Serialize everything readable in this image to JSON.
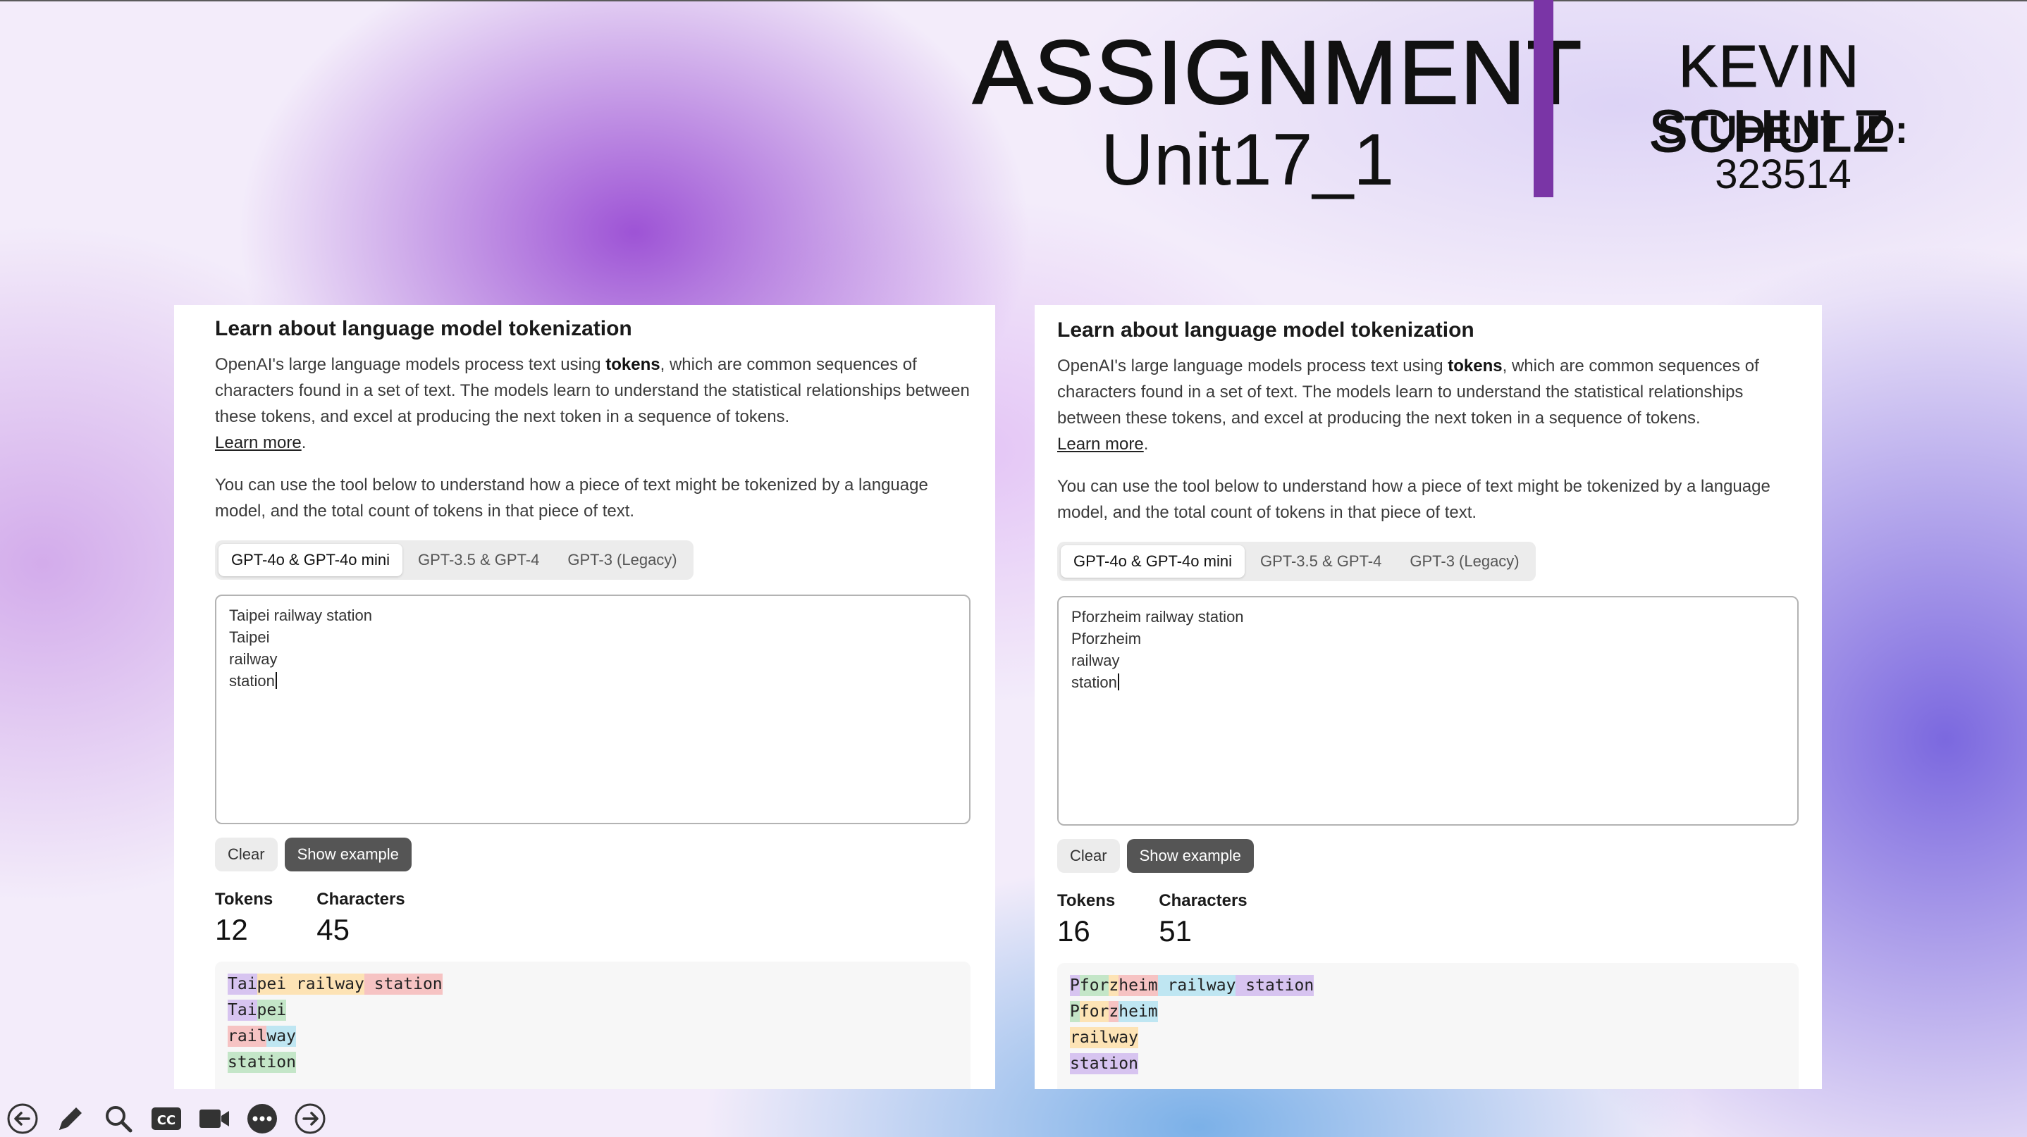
{
  "header": {
    "title": "ASSIGNMENT",
    "subtitle": "Unit17_1",
    "student_name": "KEVIN SCHULZ",
    "student_id_label": "STUDENT ID:",
    "student_id": "323514",
    "accent_color": "#7a35a6"
  },
  "panels": [
    {
      "title": "Learn about language model tokenization",
      "intro_before": "OpenAI's large language models process text using ",
      "intro_bold": "tokens",
      "intro_after": ", which are common sequences of characters found in a set of text. The models learn to understand the statistical relationships between these tokens, and excel at producing the next token in a sequence of tokens.",
      "learn_more": "Learn more",
      "learn_more_suffix": ".",
      "paragraph2": "You can use the tool below to understand how a piece of text might be tokenized by a language model, and the total count of tokens in that piece of text.",
      "tabs": [
        "GPT-4o & GPT-4o mini",
        "GPT-3.5 & GPT-4",
        "GPT-3 (Legacy)"
      ],
      "active_tab": 0,
      "input_lines": [
        "Taipei railway station",
        "Taipei",
        "railway",
        "station"
      ],
      "buttons": {
        "clear": "Clear",
        "example": "Show example"
      },
      "stats": {
        "tokens_label": "Tokens",
        "tokens": "12",
        "chars_label": "Characters",
        "chars": "45"
      },
      "token_lines": [
        [
          {
            "t": "Tai",
            "c": "#d7c4f0"
          },
          {
            "t": "pei",
            "c": "#fde3b5"
          },
          {
            "t": " railway",
            "c": "#fde3b5"
          },
          {
            "t": " station",
            "c": "#f6c3c3"
          }
        ],
        [
          {
            "t": "Tai",
            "c": "#d7c4f0"
          },
          {
            "t": "pei",
            "c": "#c4e6c8"
          }
        ],
        [
          {
            "t": "rail",
            "c": "#f6c3c3"
          },
          {
            "t": "way",
            "c": "#bfe6f2"
          }
        ],
        [
          {
            "t": "station",
            "c": "#c4e6c8"
          }
        ]
      ]
    },
    {
      "title": "Learn about language model tokenization",
      "intro_before": "OpenAI's large language models process text using ",
      "intro_bold": "tokens",
      "intro_after": ", which are common sequences of characters found in a set of text. The models learn to understand the statistical relationships between these tokens, and excel at producing the next token in a sequence of tokens.",
      "learn_more": "Learn more",
      "learn_more_suffix": ".",
      "paragraph2": "You can use the tool below to understand how a piece of text might be tokenized by a language model, and the total count of tokens in that piece of text.",
      "tabs": [
        "GPT-4o & GPT-4o mini",
        "GPT-3.5 & GPT-4",
        "GPT-3 (Legacy)"
      ],
      "active_tab": 0,
      "input_lines": [
        "Pforzheim railway station",
        "Pforzheim",
        "railway",
        "station"
      ],
      "buttons": {
        "clear": "Clear",
        "example": "Show example"
      },
      "stats": {
        "tokens_label": "Tokens",
        "tokens": "16",
        "chars_label": "Characters",
        "chars": "51"
      },
      "token_lines": [
        [
          {
            "t": "P",
            "c": "#d7c4f0"
          },
          {
            "t": "for",
            "c": "#c4e6c8"
          },
          {
            "t": "z",
            "c": "#fde3b5"
          },
          {
            "t": "heim",
            "c": "#f6c3c3"
          },
          {
            "t": " railway",
            "c": "#bfe6f2"
          },
          {
            "t": " station",
            "c": "#d7c4f0"
          }
        ],
        [
          {
            "t": "P",
            "c": "#c4e6c8"
          },
          {
            "t": "for",
            "c": "#fde3b5"
          },
          {
            "t": "z",
            "c": "#f6c3c3"
          },
          {
            "t": "heim",
            "c": "#bfe6f2"
          }
        ],
        [
          {
            "t": "railway",
            "c": "#fde3b5"
          }
        ],
        [
          {
            "t": "station",
            "c": "#d7c4f0"
          }
        ]
      ]
    }
  ],
  "toolbar_icons": [
    "back-arrow-icon",
    "pen-icon",
    "magnifier-icon",
    "closed-captions-icon",
    "video-camera-icon",
    "more-options-icon",
    "forward-arrow-icon"
  ]
}
